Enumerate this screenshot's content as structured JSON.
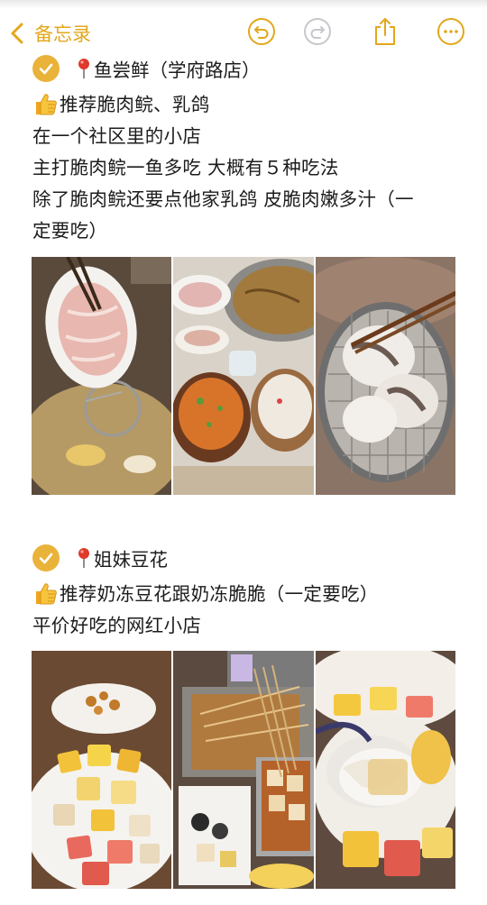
{
  "toolbar": {
    "back_label": "备忘录",
    "icons": [
      "chevron-left-icon",
      "undo-icon",
      "redo-icon",
      "share-icon",
      "more-icon"
    ]
  },
  "colors": {
    "accent": "#e3a71b",
    "check": "#e9b33a",
    "pin": "#e0392b",
    "text": "#1c1c1e"
  },
  "sections": [
    {
      "title": "鱼尝鲜（学府路店）",
      "lines": [
        "推荐脆肉鲩、乳鸽",
        "在一个社区里的小店",
        "主打脆肉鲩一鱼多吃 大概有５种吃法",
        "除了脆肉鲩还要点他家乳鸽 皮脆肉嫩多汁（一",
        "定要吃）"
      ],
      "photos": [
        "fish-slices-photo",
        "hotpot-table-photo",
        "fish-in-ladle-photo"
      ]
    },
    {
      "title": "姐妹豆花",
      "lines": [
        "推荐奶冻豆花跟奶冻脆脆（一定要吃）",
        "平价好吃的网红小店"
      ],
      "photos": [
        "fruit-dessert-photo",
        "skewers-photo",
        "spoon-dessert-photo"
      ]
    }
  ]
}
